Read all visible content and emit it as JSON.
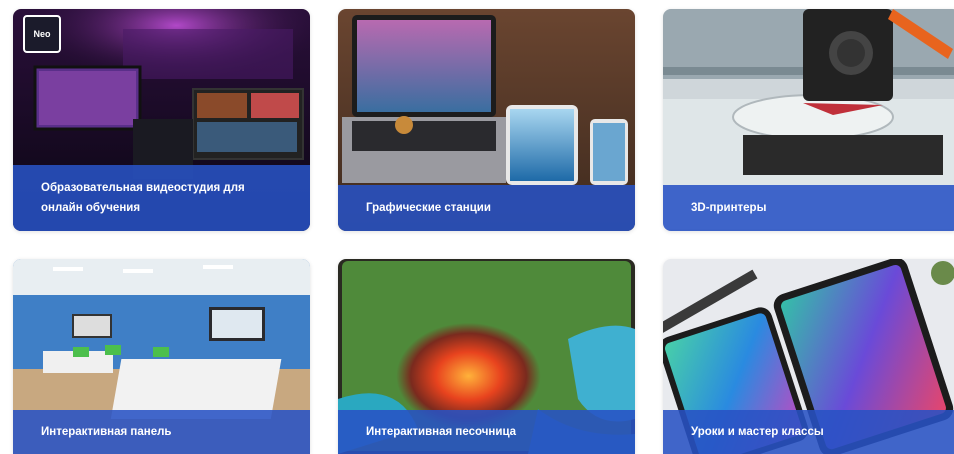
{
  "cards": [
    {
      "title": "Образовательная видеостудия для онлайн обучения",
      "logo": "Neo"
    },
    {
      "title": "Графические станции"
    },
    {
      "title": "3D-принтеры"
    },
    {
      "title": "Интерактивная панель"
    },
    {
      "title": "Интерактивная песочница"
    },
    {
      "title": "Уроки и мастер классы"
    }
  ],
  "colors": {
    "caption_overlay": "#2852c4"
  }
}
